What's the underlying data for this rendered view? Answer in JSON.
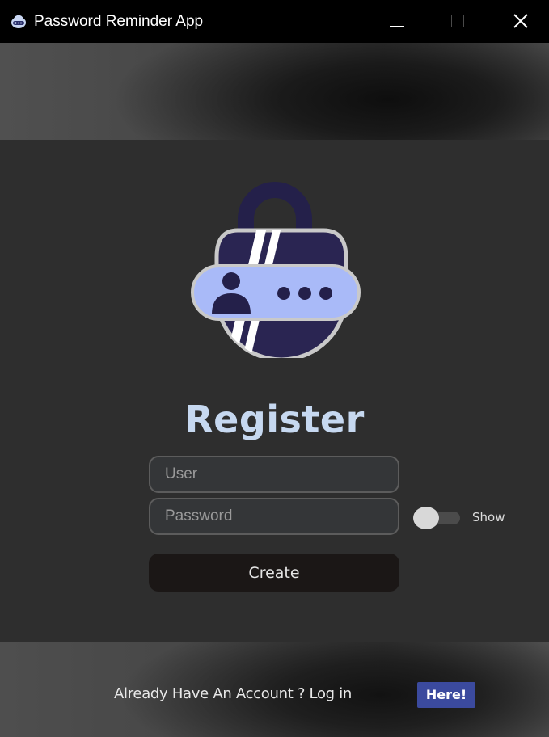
{
  "window": {
    "title": "Password Reminder App"
  },
  "heading": "Register",
  "form": {
    "user_placeholder": "User",
    "password_placeholder": "Password",
    "show_label": "Show",
    "show_enabled": false,
    "create_label": "Create"
  },
  "footer": {
    "prompt_text": "Already Have An Account ? Log in",
    "here_label": "Here!"
  },
  "colors": {
    "titlebar": "#000000",
    "background": "#2e2e2e",
    "heading": "#c6d8f0",
    "create_button": "#1b1716",
    "here_button": "#3b4a9e",
    "logo_dark": "#24204a",
    "logo_light": "#a9baf8"
  },
  "icons": {
    "app": "app-logo-icon",
    "minimize": "minimize-icon",
    "maximize": "maximize-icon",
    "close": "close-icon",
    "logo": "padlock-user-icon"
  }
}
